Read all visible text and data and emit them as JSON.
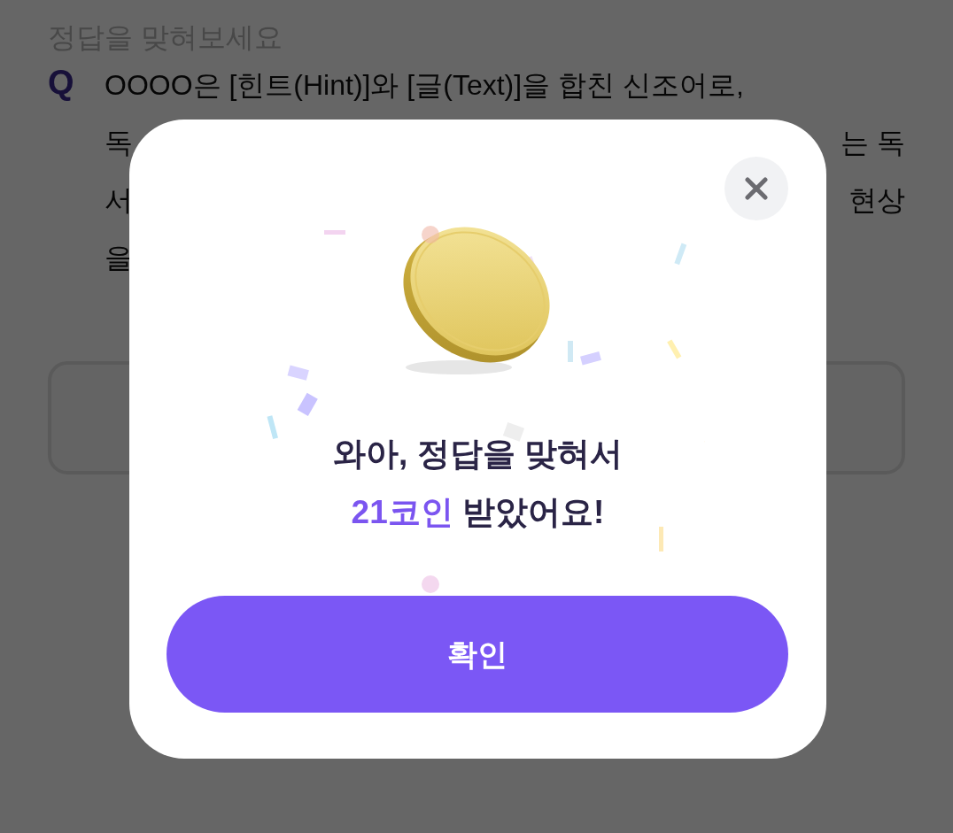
{
  "page": {
    "heading": "정답을 맞혀보세요",
    "question": {
      "marker": "Q",
      "lines": [
        {
          "left": "OOOO은 [힌트(Hint)]와 [글(Text)]을 합친 신조어로,"
        },
        {
          "left": "독",
          "right": "는 독"
        },
        {
          "left": "서",
          "right": "현상"
        },
        {
          "left": "을"
        }
      ]
    }
  },
  "dialog": {
    "message": "와아, 정답을 맞혀서",
    "reward": "21코인",
    "reward_suffix": "받았어요!",
    "button": "확인"
  }
}
